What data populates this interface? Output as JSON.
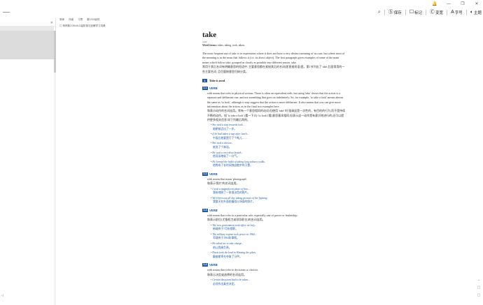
{
  "window": {
    "controls": [
      "🔔",
      "—",
      "❐",
      "✕"
    ]
  },
  "toolbar": {
    "search_icon": "search-icon",
    "buttons": [
      {
        "icon": "Ⓢ",
        "label": "保存"
      },
      {
        "icon": "☐",
        "label": "标记"
      },
      {
        "icon": "Ⓒ",
        "label": "变宽"
      },
      {
        "icon": "A",
        "label": "字号"
      },
      {
        "icon": "◐",
        "label": "主题"
      }
    ]
  },
  "tabs": [
    "简单",
    "详细",
    "习惯",
    "第2/3/5级别"
  ],
  "left_panel": {
    "bottom_text": "→)"
  },
  "breadcrumb": "柯林斯COBUILD高阶英汉双解学习词典",
  "entry": {
    "headword": "take",
    "pronunciation": "/teɪk/",
    "wordforms_label": "Word forms:",
    "wordforms": "takes, taking, took, taken.",
    "intro_en": "The most frequent use of take is in expressions where it does not have a very distinct meaning of its own, but where most of the meaning is in the noun that follows it (i.e. its direct object). The first paragraph gives examples of some of the main nouns which follow take, grouped as clearly as possible into different senses. take",
    "intro_cn": "常用于其后名词有明确意思的短语中, 主要意思都在紧接其后的名词(即直接宾语)里。第1节列出了 take 后面常用的一些主要名词, 且尽量按意思归纳分类。",
    "sense1_num": "1",
    "sense1_title": "Take is used",
    "senses": [
      {
        "num": "1.1",
        "pos": "VERB",
        "def_en": "with nouns that refer to physical actions. There is often an equivalent verb, but using 'take' shows that the action is a separate and deliberate one, and not something that goes on indefinitely. So, for example, 'to take a look' means almost the same as 'to look', although it may suggest that the action is more deliberate. It also means that you can give more information about the action, as in the final two examples here.",
        "def_cn": "和表示动作的名词连用。常有一个意思相同的动词,但使用 'take' 时,强调这是一次性的、有目的的行为,而不是持续不断的动作。如 'to take a look' (看一下)与 'to look' (看)意思基本相同,但表示这一动作是有意识地进行的,还可以提供更多相关信息,如下列最后两例。",
        "examples": [
          {
            "en": "She took a step towards look...",
            "cn": "她朝前迈出了一步。"
          },
          {
            "en": "If he had taken a nap after lunch...",
            "cn": "午饭后他要是打了个盹儿……"
          },
          {
            "en": "She took a shower...",
            "cn": "她洗了个淋浴。"
          },
          {
            "en": "He took a very deep breath...",
            "cn": "他深深地吸了一口气。"
          },
          {
            "en": "He formed the habit of taking long solitary walks.",
            "cn": "他养成了长时间独自散步的习惯。"
          }
        ]
      },
      {
        "num": "1.2",
        "pos": "VERB",
        "def_en": "with nouns that mean 'photograph'.",
        "def_cn": "和表示'照片'的名词连用。",
        "examples": [
          {
            "en": "I took a magnificent photo of him...",
            "cn": "我给他照了一张很出色的照片。"
          },
          {
            "en": "We'd been out all day taking pictures of the fighting.",
            "cn": "我整天在外面拍摄战斗场面的照片。"
          }
        ]
      },
      {
        "num": "1.3",
        "pos": "VERB",
        "def_en": "with nouns that refer to a particular role, especially one of power or leadership.",
        "def_cn": "和表示职位(尤指权力或领导职位)的名词连用。",
        "examples": [
          {
            "en": "The new government took office on July...",
            "cn": "新政府于7月份就职。"
          },
          {
            "en": "The military regime took power in 1964...",
            "cn": "军政府于1964年掌权。"
          },
          {
            "en": "He asked me to take charge...",
            "cn": "他让我来负责。"
          },
          {
            "en": "Davis took the lead in Winning the gilets.",
            "cn": "戴维斯率先夺取了马甲。"
          }
        ]
      },
      {
        "num": "1.4",
        "pos": "VERB",
        "def_en": "with nouns that refer to decisions or choices.",
        "def_cn": "和表示决定或选择的名词连用。",
        "examples": [
          {
            "en": "Certain decisions had to be taken...",
            "cn": "必须作出某些决定。"
          }
        ]
      }
    ]
  },
  "right_icons": [
    "⌄",
    "▢",
    "▢"
  ]
}
